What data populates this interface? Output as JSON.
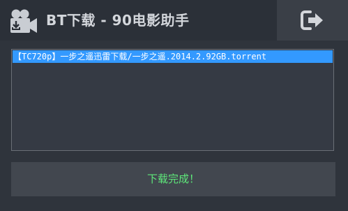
{
  "window": {
    "title": "BT下载 - 90电影助手"
  },
  "icons": {
    "app": "camera-download-icon",
    "exit": "exit-icon"
  },
  "file_list": {
    "items": [
      {
        "label": "【TC720p】一步之遥迅雷下载/一步之遥.2014.2.92GB.torrent",
        "selected": true
      }
    ]
  },
  "status": {
    "text": "下载完成！"
  },
  "colors": {
    "background": "#2f343c",
    "titlebar": "#2b3038",
    "exit_button": "#3a3f47",
    "selection": "#3399ff",
    "status_text": "#5ee87a"
  }
}
